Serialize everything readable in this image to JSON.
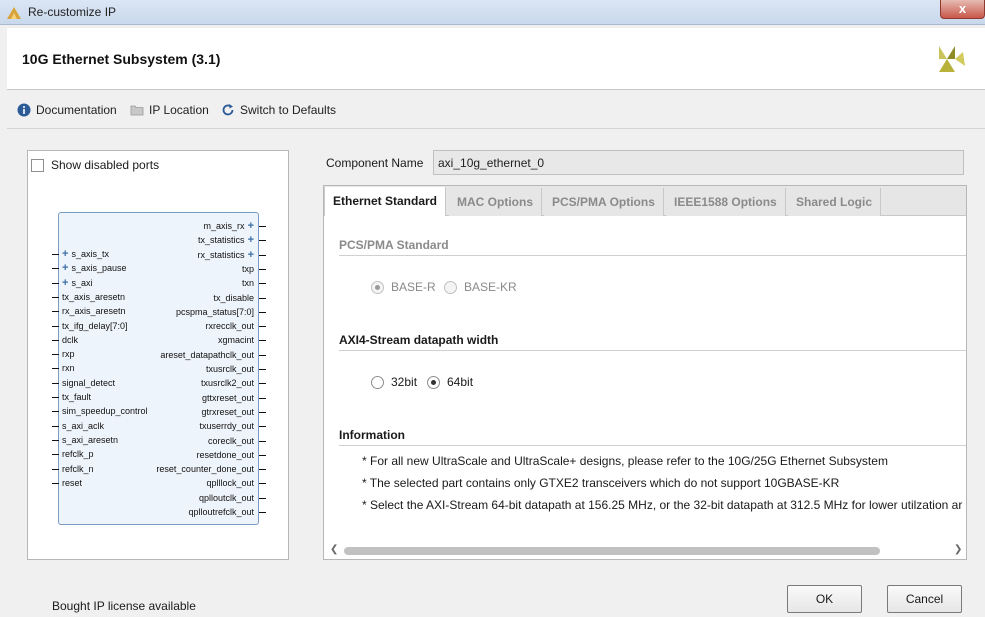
{
  "window": {
    "title": "Re-customize IP",
    "close_label": "x"
  },
  "header": {
    "title": "10G Ethernet Subsystem (3.1)",
    "logo_icon": "xilinx-logo"
  },
  "toolbar": {
    "documentation": "Documentation",
    "ip_location": "IP Location",
    "switch_defaults": "Switch to Defaults"
  },
  "left_panel": {
    "show_disabled_ports": "Show disabled ports",
    "left_ports": [
      "s_axis_tx",
      "s_axis_pause",
      "s_axi",
      "tx_axis_aresetn",
      "rx_axis_aresetn",
      "tx_ifg_delay[7:0]",
      "dclk",
      "rxp",
      "rxn",
      "signal_detect",
      "tx_fault",
      "sim_speedup_control",
      "s_axi_aclk",
      "s_axi_aresetn",
      "refclk_p",
      "refclk_n",
      "reset"
    ],
    "right_ports": [
      "m_axis_rx",
      "tx_statistics",
      "rx_statistics",
      "txp",
      "txn",
      "tx_disable",
      "pcspma_status[7:0]",
      "rxrecclk_out",
      "xgmacint",
      "areset_datapathclk_out",
      "txusrclk_out",
      "txusrclk2_out",
      "gttxreset_out",
      "gtrxreset_out",
      "txuserrdy_out",
      "coreclk_out",
      "resetdone_out",
      "reset_counter_done_out",
      "qplllock_out",
      "qplloutclk_out",
      "qplloutrefclk_out"
    ]
  },
  "component": {
    "label": "Component Name",
    "value": "axi_10g_ethernet_0"
  },
  "tabs": [
    "Ethernet Standard",
    "MAC Options",
    "PCS/PMA Options",
    "IEEE1588 Options",
    "Shared Logic"
  ],
  "pcs_pma": {
    "title": "PCS/PMA Standard",
    "options": [
      "BASE-R",
      "BASE-KR"
    ],
    "selected": "BASE-R"
  },
  "axi_stream": {
    "title": "AXI4-Stream datapath width",
    "options": [
      "32bit",
      "64bit"
    ],
    "selected": "64bit"
  },
  "information": {
    "title": "Information",
    "lines": [
      "* For all new UltraScale and UltraScale+ designs, please refer to the 10G/25G Ethernet Subsystem",
      "* The selected part contains only GTXE2 transceivers which do not support 10GBASE-KR",
      "* Select the AXI-Stream 64-bit datapath at 156.25 MHz, or the 32-bit datapath at 312.5 MHz for lower utilzation ar"
    ]
  },
  "footer": {
    "license": "Bought IP license available",
    "ok": "OK",
    "cancel": "Cancel"
  }
}
